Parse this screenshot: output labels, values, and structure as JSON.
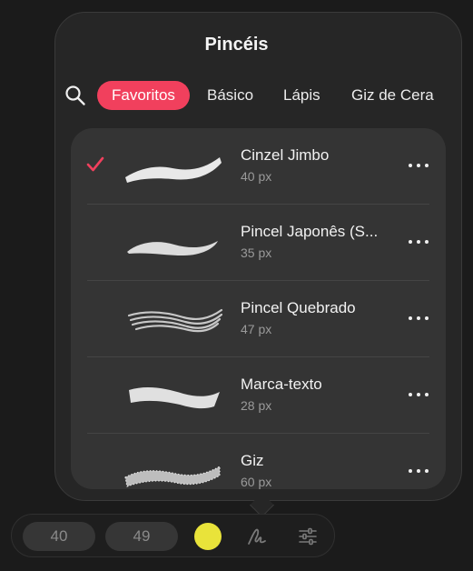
{
  "panel": {
    "title": "Pincéis",
    "tabs": [
      {
        "label": "Favoritos",
        "active": true
      },
      {
        "label": "Básico",
        "active": false
      },
      {
        "label": "Lápis",
        "active": false
      },
      {
        "label": "Giz de Cera",
        "active": false
      }
    ],
    "brushes": [
      {
        "name": "Cinzel Jimbo",
        "size": "40 px",
        "selected": true
      },
      {
        "name": "Pincel Japonês (S...",
        "size": "35 px",
        "selected": false
      },
      {
        "name": "Pincel Quebrado",
        "size": "47 px",
        "selected": false
      },
      {
        "name": "Marca-texto",
        "size": "28 px",
        "selected": false
      },
      {
        "name": "Giz",
        "size": "60 px",
        "selected": false
      }
    ]
  },
  "toolbar": {
    "size_value": "40",
    "opacity_value": "49",
    "color": "#e9e33a"
  },
  "colors": {
    "accent": "#f1405d",
    "panel": "#262626",
    "list": "#343434"
  }
}
